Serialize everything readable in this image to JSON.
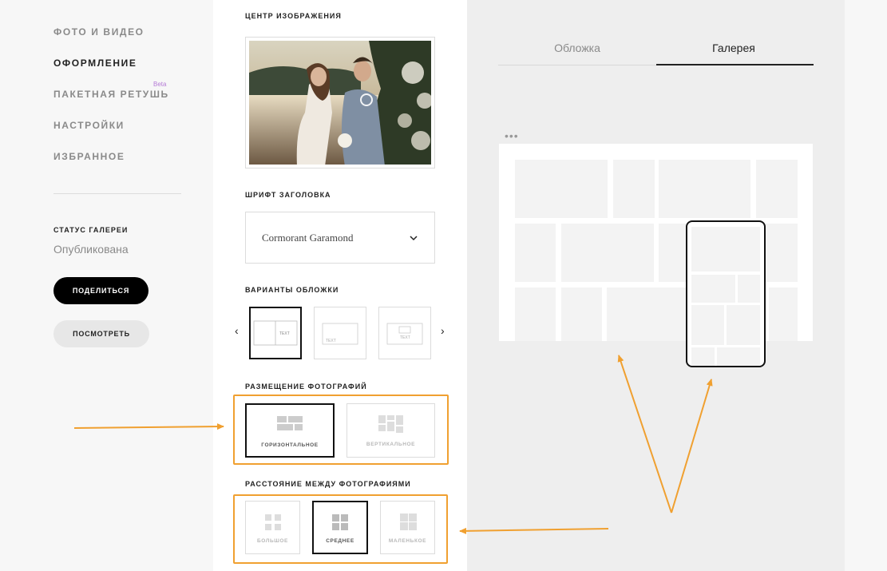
{
  "sidebar": {
    "items": [
      {
        "label": "ФОТО И ВИДЕО"
      },
      {
        "label": "ОФОРМЛЕНИЕ"
      },
      {
        "label": "ПАКЕТНАЯ РЕТУШЬ"
      },
      {
        "label": "НАСТРОЙКИ"
      },
      {
        "label": "ИЗБРАННОЕ"
      }
    ],
    "beta": "Beta",
    "status_label": "СТАТУС ГАЛЕРЕИ",
    "status_value": "Опубликована",
    "share_button": "ПОДЕЛИТЬСЯ",
    "view_button": "ПОСМОТРЕТЬ"
  },
  "design": {
    "image_center_title": "ЦЕНТР ИЗОБРАЖЕНИЯ",
    "font_title": "ШРИФТ ЗАГОЛОВКА",
    "font_value": "Cormorant Garamond",
    "cover_title": "ВАРИАНТЫ ОБЛОЖКИ",
    "cover_text": "TEXT",
    "layout_title": "РАЗМЕЩЕНИЕ ФОТОГРАФИЙ",
    "layout_options": [
      {
        "label": "ГОРИЗОНТАЛЬНОЕ",
        "selected": true
      },
      {
        "label": "ВЕРТИКАЛЬНОЕ",
        "selected": false
      }
    ],
    "spacing_title": "РАССТОЯНИЕ МЕЖДУ ФОТОГРАФИЯМИ",
    "spacing_options": [
      {
        "label": "БОЛЬШОЕ",
        "selected": false
      },
      {
        "label": "СРЕДНЕЕ",
        "selected": true
      },
      {
        "label": "МАЛЕНЬКОЕ",
        "selected": false
      }
    ]
  },
  "preview": {
    "tabs": [
      {
        "label": "Обложка",
        "active": false
      },
      {
        "label": "Галерея",
        "active": true
      }
    ],
    "dots": "•••"
  },
  "colors": {
    "accent": "#f0a030",
    "selected_border": "#111111",
    "beta": "#b57bd6"
  }
}
